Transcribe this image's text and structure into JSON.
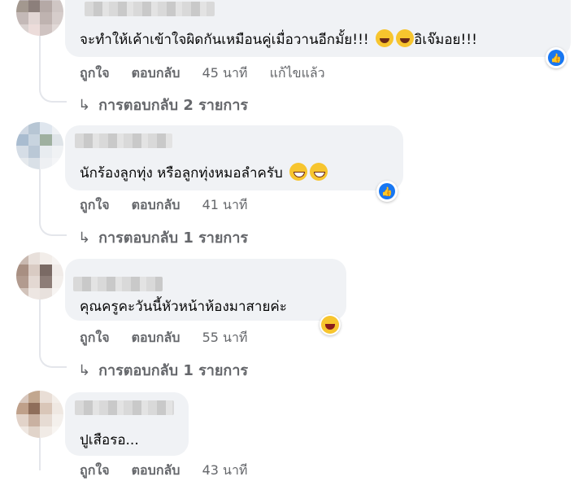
{
  "comments": [
    {
      "text": "จะทำให้เค้าเข้าใจผิดกันเหมือนคู่เมื่อวานอีกมั้ย!!! ",
      "emoji_after": [
        "laugh-emoji",
        "laugh-emoji"
      ],
      "text_tail": "อิเจ๊มอย!!!",
      "actions": {
        "like": "ถูกใจ",
        "reply": "ตอบกลับ",
        "time": "45 นาที",
        "edited": "แก้ไขแล้ว"
      },
      "replies": "การตอบกลับ 2 รายการ",
      "reaction": "like-icon"
    },
    {
      "text": "นักร้องลูกทุ่ง หรือลูกทุ่งหมอลำครับ",
      "emoji_after": [
        "grin-emoji",
        "grin-emoji"
      ],
      "actions": {
        "like": "ถูกใจ",
        "reply": "ตอบกลับ",
        "time": "41 นาที"
      },
      "replies": "การตอบกลับ 1 รายการ",
      "reaction": "like-icon"
    },
    {
      "text": "คุณครูคะวันนี้หัวหน้าห้องมาสายค่ะ",
      "actions": {
        "like": "ถูกใจ",
        "reply": "ตอบกลับ",
        "time": "55 นาที"
      },
      "replies": "การตอบกลับ 1 รายการ",
      "reaction": "haha-icon"
    },
    {
      "text": "ปูเสือรอ...",
      "actions": {
        "like": "ถูกใจ",
        "reply": "ตอบกลับ",
        "time": "43 นาที"
      }
    }
  ],
  "colors": {
    "bubble": "#f0f2f5",
    "meta": "#65676b",
    "like_blue": "#1877f2"
  }
}
